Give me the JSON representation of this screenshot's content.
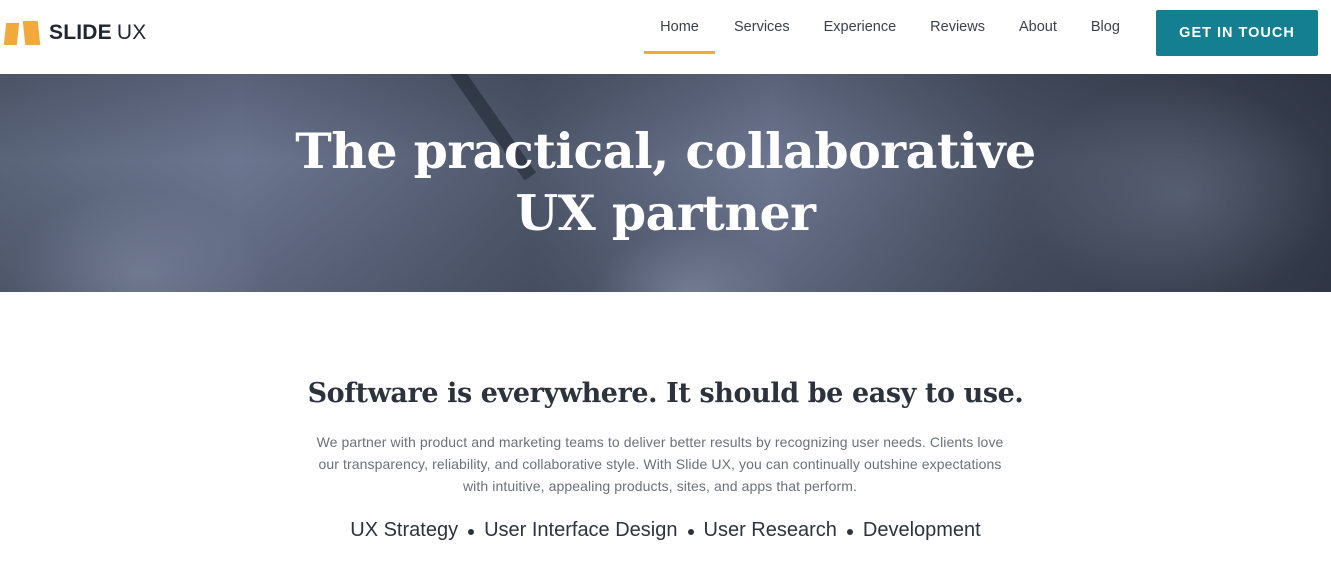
{
  "brand": {
    "name_bold": "SLIDE",
    "name_light": "UX",
    "accent_color": "#f2a93b",
    "icon": "slide-ux-logo"
  },
  "nav": {
    "items": [
      {
        "label": "Home",
        "active": true
      },
      {
        "label": "Services",
        "active": false
      },
      {
        "label": "Experience",
        "active": false
      },
      {
        "label": "Reviews",
        "active": false
      },
      {
        "label": "About",
        "active": false
      },
      {
        "label": "Blog",
        "active": false
      }
    ],
    "cta_label": "GET IN TOUCH",
    "cta_color": "#137f91"
  },
  "hero": {
    "title_line1": "The practical, collaborative",
    "title_line2": "UX partner"
  },
  "content": {
    "headline": "Software is everywhere. It should be easy to use.",
    "intro_line1": "We partner with product and marketing teams to deliver better results by recognizing user needs. Clients love",
    "intro_line2": "our transparency, reliability, and collaborative style. With Slide UX, you can continually outshine expectations",
    "intro_line3": "with intuitive, appealing products, sites, and apps that perform.",
    "services": [
      "UX Strategy",
      "User Interface Design",
      "User Research",
      "Development"
    ]
  }
}
